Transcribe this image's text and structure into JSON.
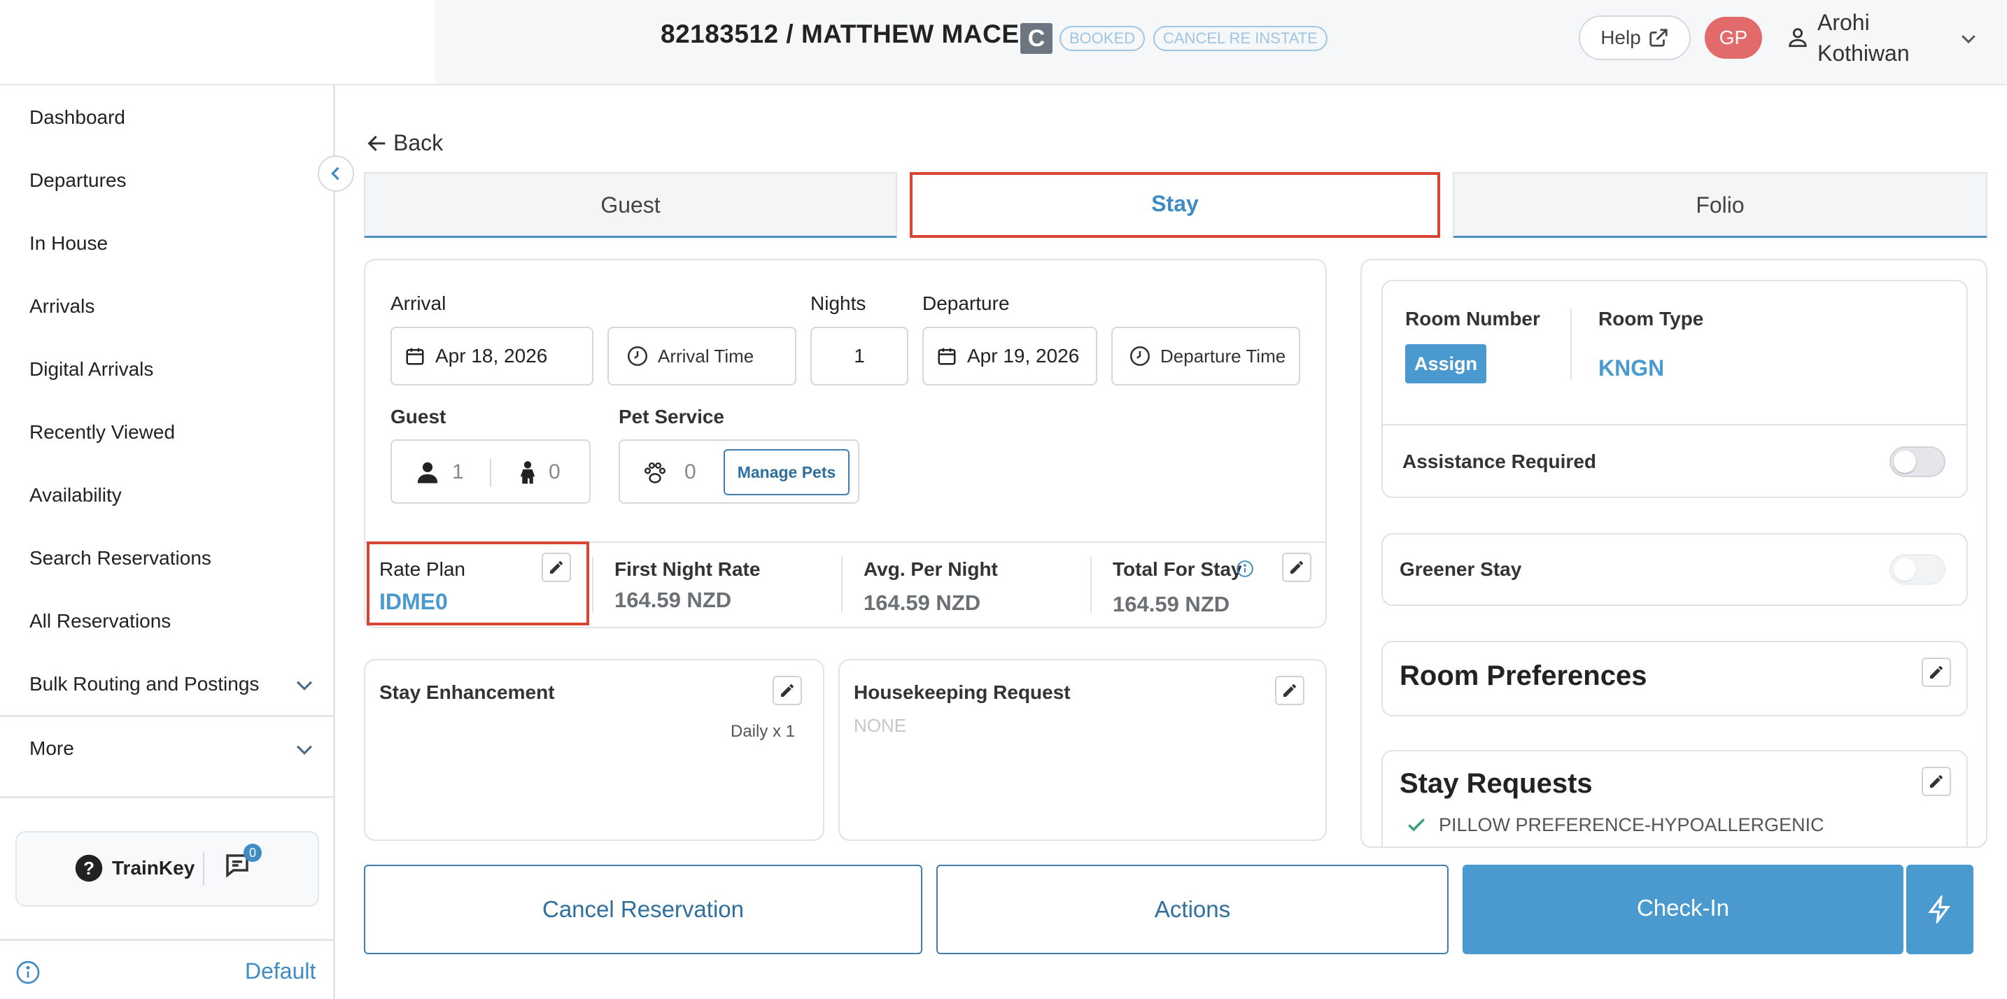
{
  "header": {
    "title": "82183512 / MATTHEW MACE",
    "c_badge": "C",
    "status_pills": [
      "BOOKED",
      "CANCEL RE INSTATE"
    ],
    "help_label": "Help",
    "avatar_initials": "GP",
    "user_first": "Arohi",
    "user_last": "Kothiwan"
  },
  "sidebar": {
    "items": [
      {
        "label": "Dashboard"
      },
      {
        "label": "Departures"
      },
      {
        "label": "In House"
      },
      {
        "label": "Arrivals"
      },
      {
        "label": "Digital Arrivals"
      },
      {
        "label": "Recently Viewed"
      },
      {
        "label": "Availability"
      },
      {
        "label": "Search Reservations"
      },
      {
        "label": "All Reservations"
      },
      {
        "label": "Bulk Routing and Postings"
      },
      {
        "label": "More"
      }
    ],
    "trainkey_label": "TrainKey",
    "chat_count": "0",
    "footer_label": "Default"
  },
  "main": {
    "back_label": "Back",
    "tabs": [
      {
        "label": "Guest"
      },
      {
        "label": "Stay"
      },
      {
        "label": "Folio"
      }
    ],
    "stay": {
      "arrival_label": "Arrival",
      "arrival_date": "Apr 18, 2026",
      "arrival_time_placeholder": "Arrival Time",
      "nights_label": "Nights",
      "nights_value": "1",
      "departure_label": "Departure",
      "departure_date": "Apr 19, 2026",
      "departure_time_placeholder": "Departure Time",
      "guest_label": "Guest",
      "adults": "1",
      "children": "0",
      "pet_label": "Pet Service",
      "pets": "0",
      "manage_pets_label": "Manage Pets"
    },
    "rates": {
      "rate_plan_label": "Rate Plan",
      "rate_plan_value": "IDME0",
      "first_night_label": "First Night Rate",
      "first_night_value": "164.59 NZD",
      "avg_label": "Avg. Per Night",
      "avg_value": "164.59 NZD",
      "total_label": "Total For Stay",
      "total_value": "164.59 NZD"
    },
    "enhancement": {
      "title": "Stay Enhancement",
      "daily": "Daily x 1"
    },
    "housekeeping": {
      "title": "Housekeeping Request",
      "value": "NONE"
    },
    "room": {
      "room_number_label": "Room Number",
      "assign_label": "Assign",
      "room_type_label": "Room Type",
      "room_type_value": "KNGN",
      "assistance_label": "Assistance Required",
      "greener_label": "Greener Stay",
      "preferences_label": "Room Preferences",
      "requests_label": "Stay Requests",
      "request_item": "PILLOW PREFERENCE-HYPOALLERGENIC"
    },
    "footer": {
      "cancel_label": "Cancel Reservation",
      "actions_label": "Actions",
      "checkin_label": "Check-In"
    }
  },
  "colors": {
    "accent_blue": "#4a9ad0",
    "highlight_red": "#d84533",
    "avatar_red": "#e26a6a"
  }
}
